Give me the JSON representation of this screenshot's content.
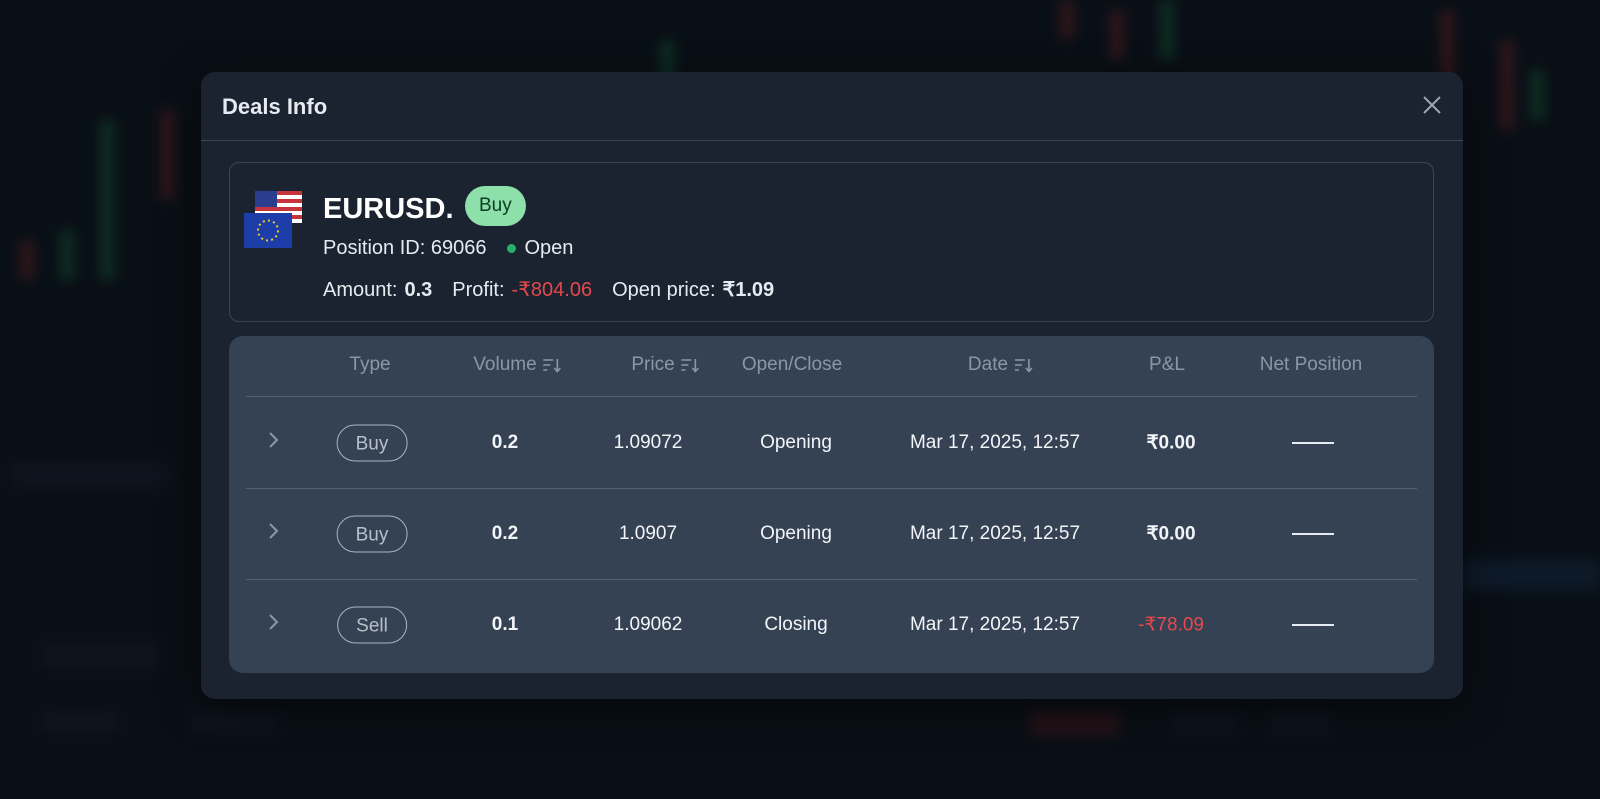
{
  "modal": {
    "title": "Deals Info"
  },
  "position": {
    "symbol": "EURUSD.",
    "side_badge": "Buy",
    "position_id_label": "Position ID: 69066",
    "status": "Open",
    "amount_label": "Amount:",
    "amount_value": "0.3",
    "profit_label": "Profit:",
    "profit_value": "-₹804.06",
    "open_price_label": "Open price:",
    "open_price_value": "₹1.09"
  },
  "table": {
    "headers": {
      "type": "Type",
      "volume": "Volume",
      "price": "Price",
      "open_close": "Open/Close",
      "date": "Date",
      "pnl": "P&L",
      "net_position": "Net Position"
    },
    "rows": [
      {
        "type": "Buy",
        "volume": "0.2",
        "price": "1.09072",
        "open_close": "Opening",
        "date": "Mar 17, 2025, 12:57",
        "pnl": "₹0.00",
        "pnl_negative": false
      },
      {
        "type": "Buy",
        "volume": "0.2",
        "price": "1.0907",
        "open_close": "Opening",
        "date": "Mar 17, 2025, 12:57",
        "pnl": "₹0.00",
        "pnl_negative": false
      },
      {
        "type": "Sell",
        "volume": "0.1",
        "price": "1.09062",
        "open_close": "Closing",
        "date": "Mar 17, 2025, 12:57",
        "pnl": "-₹78.09",
        "pnl_negative": true
      }
    ]
  },
  "colors": {
    "modal_bg": "#1b2331",
    "table_bg": "#354253",
    "buy_badge": "#8de0a9",
    "negative": "#e5484d",
    "status_open": "#27b268"
  },
  "icons": {
    "close": "close-icon",
    "expand": "chevron-right-icon",
    "sort": "sort-icon",
    "flag_us": "us-flag-icon",
    "flag_eu": "eu-flag-icon"
  }
}
